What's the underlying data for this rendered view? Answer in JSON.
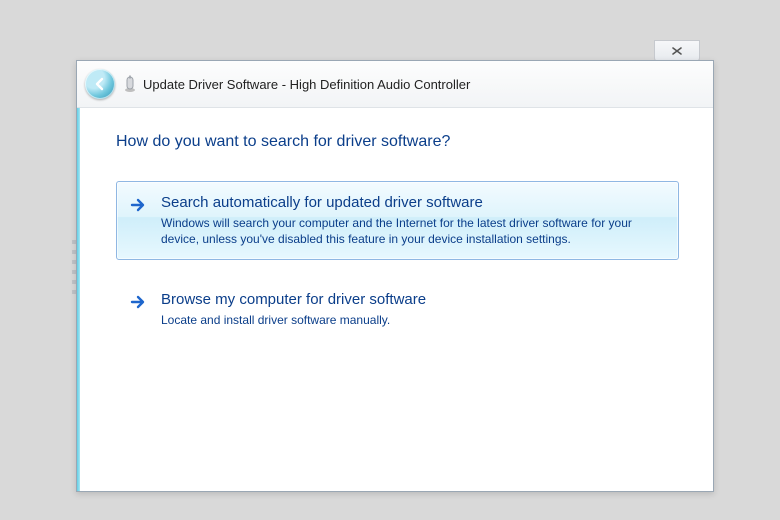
{
  "wizard": {
    "title": "Update Driver Software - High Definition Audio Controller",
    "heading": "How do you want to search for driver software?",
    "options": [
      {
        "title": "Search automatically for updated driver software",
        "description": "Windows will search your computer and the Internet for the latest driver software for your device, unless you've disabled this feature in your device installation settings."
      },
      {
        "title": "Browse my computer for driver software",
        "description": "Locate and install driver software manually."
      }
    ]
  }
}
